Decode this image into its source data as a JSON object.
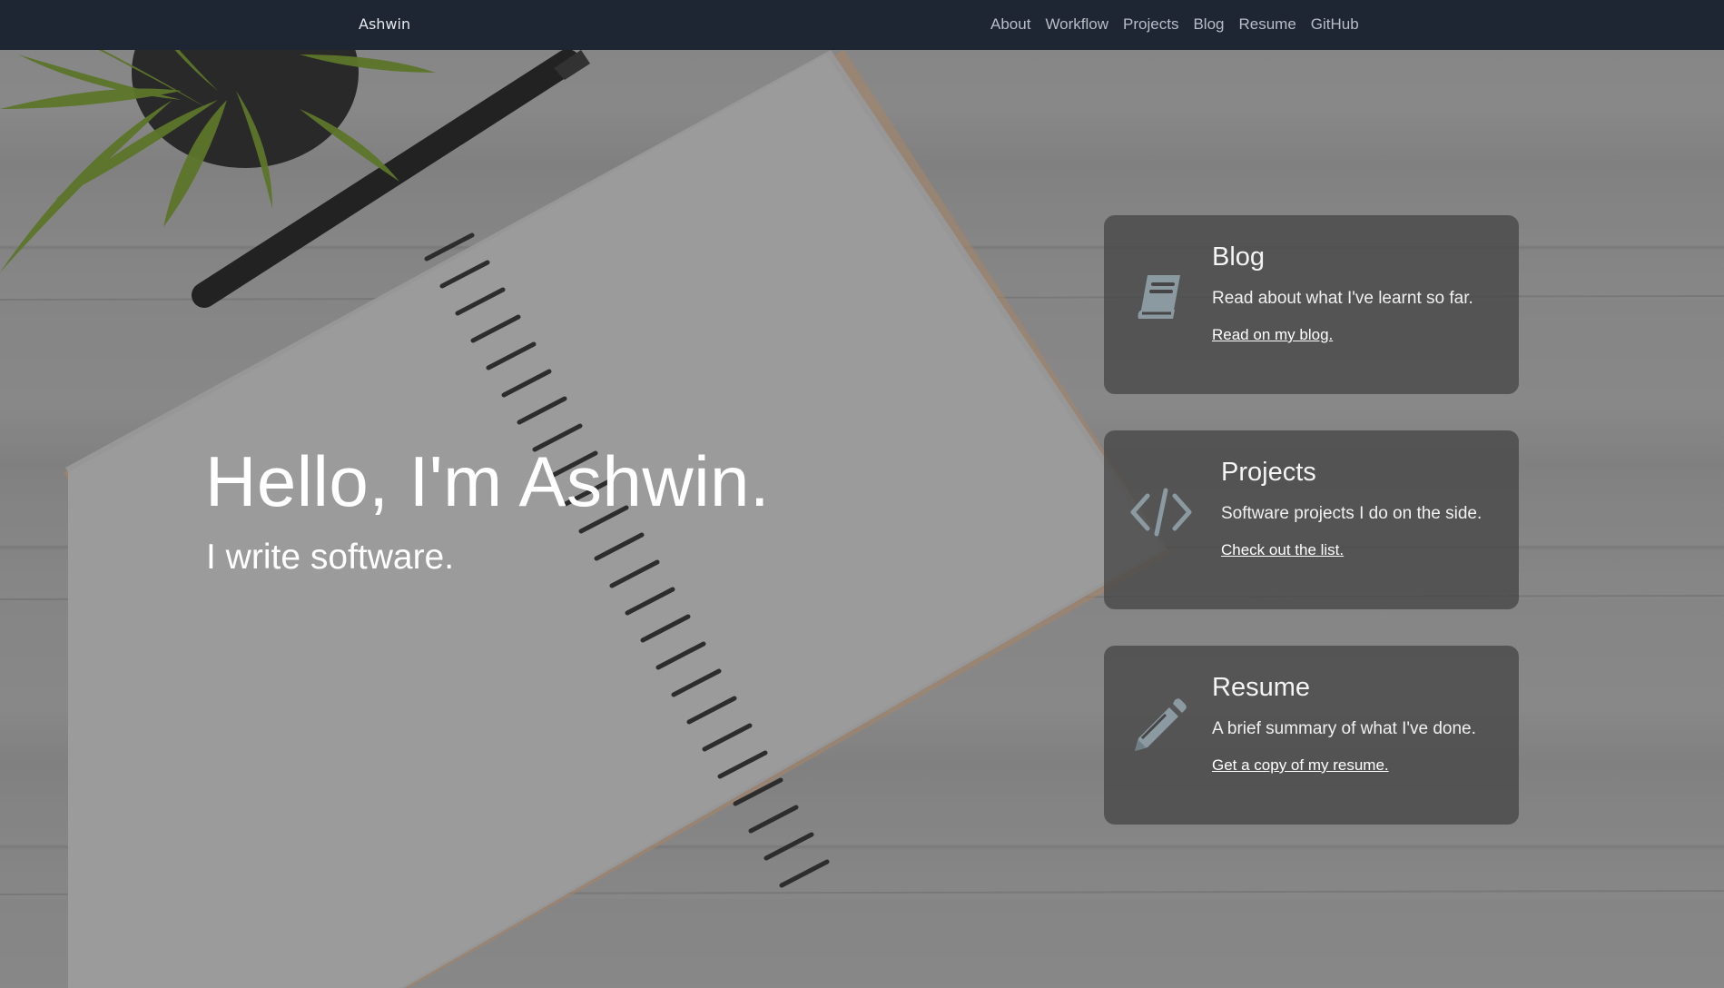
{
  "navbar": {
    "brand": "Ashwin",
    "links": [
      "About",
      "Workflow",
      "Projects",
      "Blog",
      "Resume",
      "GitHub"
    ]
  },
  "hero": {
    "title": "Hello, I'm Ashwin.",
    "subtitle": "I write software."
  },
  "cards": [
    {
      "title": "Blog",
      "description": "Read about what I've learnt so far.",
      "link": "Read on my blog.",
      "icon": "book-icon"
    },
    {
      "title": "Projects",
      "description": "Software projects I do on the side.",
      "link": "Check out the list.",
      "icon": "code-icon"
    },
    {
      "title": "Resume",
      "description": "A brief summary of what I've done.",
      "link": "Get a copy of my resume.",
      "icon": "pencil-icon"
    }
  ],
  "colors": {
    "navbar_bg": "#1e2533",
    "card_bg": "#464646",
    "icon": "#8a9aa0",
    "text": "#ffffff"
  }
}
